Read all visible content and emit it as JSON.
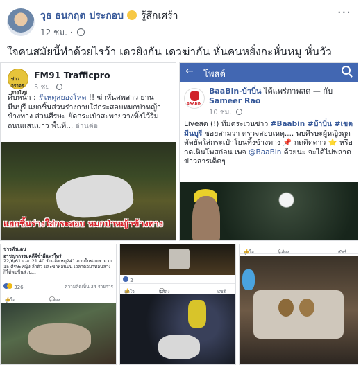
{
  "post": {
    "author": "วุธ ธนกฤต ประกอบ",
    "feeling": "รู้สึกเศร้า",
    "time": "12 ชม.",
    "more_label": "···",
    "text": "ใจคนสมัยนี้ทำด้วยไรว้า เดวยิงกัน เดวฆ่ากัน หั่นคนหยั่งกะหั่นหมู หั่นวัว"
  },
  "shared_left": {
    "logo_text": "ข่าวจราจร สายใหม่",
    "page_name": "FM91 Trafficpro",
    "time": "5 ชม.",
    "text_prefix": "คืบหน้า : ",
    "hashtag": "#เหตุสยองโหด",
    "text_body": " !! ฆ่าหั่นศพสาว ย่านมีนบุรี แยกชิ้นส่วนร่างกายใส่กระสอบหมกป่าหญ้าข้างทาง ส่วนศีรษะ ยัดกระเป๋าสะพายวางทิ้งไว้ริมถนนแสนมาว พื้นที่...",
    "see_more": "อ่านต่อ",
    "photo_caption": "แยกชิ้นร่างใส่กระสอบ หมกป่าหญ้าข้างทาง"
  },
  "shared_right": {
    "topbar_title": "โพสต์",
    "back_icon": "back-arrow-icon",
    "page_name": "BaaBin-บ้าบิ่น",
    "header_rest": " ได้แพร่ภาพสด — กับ ",
    "with_name": "Sameer Rao",
    "time": "10 ชม.",
    "logo_text": "BAABIN",
    "text_1": "Liveสด (!) ทีมตระเวนข่าว ",
    "tag_1": "#Baabin #บ้าบิ่น #เขตมีนบุรี",
    "text_2": " ซอยสามวา ตรวจสอบเหตุ.... พบศีรษะผู้หญิงถูกตัดยัดใส่กระเป๋าโยนทิ้งข้างทาง 📌 กดติดดาว ⭐ หรือ กดเห็นโพสก่อน เพจ ",
    "mention": "@BaaBin",
    "text_3": " ด้วยนะ จะได้ไม่พลาดข่าวสารเด็ดๆ"
  },
  "bottom_left": {
    "heading": "ข่าวทั่วแดน\nอาชญากรรมคดีผีซ้ำผีแพร่ใหร่",
    "text": "22/6/61 เวลา21.40 รับแจ้งเหตุ241 ภายในซอยสามวา 15 ศีรษะหญิง ลำตัว และขาท่อนบน เวลาต่อมาท่อนล่างก็ได้พบชิ้นส่วน...",
    "react_count": "326",
    "stats": "ความคิดเห็น 34 รายการ",
    "like": "ถูกใจ",
    "comment": "แสดงความคิดเห็น"
  },
  "bottom_mid": {
    "react_count": "2",
    "like": "ถูกใจ",
    "comment": "แสดงความคิดเห็น",
    "share": "แชร์"
  },
  "bottom_right": {
    "like": "ถูกใจ",
    "comment": "แสดงความคิดเห็น",
    "share": "แชร์"
  }
}
